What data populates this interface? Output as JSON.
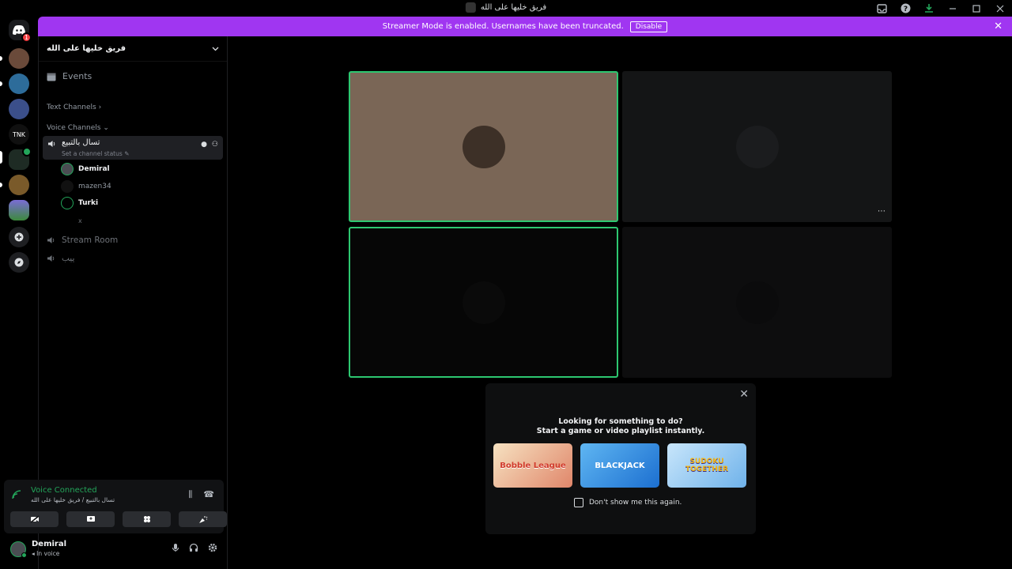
{
  "window": {
    "title": "فريق خليها على الله",
    "icons": [
      "inbox-icon",
      "help-icon",
      "download-icon",
      "minimize-icon",
      "maximize-icon",
      "close-icon"
    ]
  },
  "banner": {
    "text": "Streamer Mode is enabled. Usernames have been truncated.",
    "button": "Disable"
  },
  "rail": {
    "badge": "1",
    "servers": [
      "",
      "",
      "",
      "TNK",
      "",
      "",
      ""
    ]
  },
  "guild": {
    "name": "فريق خليها على الله"
  },
  "sidebar": {
    "events": "Events",
    "text_channels": "Text Channels",
    "voice_channels": "Voice Channels",
    "active_channel": {
      "name": "تسال بالتبيع",
      "status": "Set a channel status"
    },
    "members": [
      {
        "name": "Demiral",
        "bold": true
      },
      {
        "name": "mazen34",
        "bold": false
      },
      {
        "name": "Turki",
        "bold": true
      },
      {
        "name": "x",
        "bold": false
      }
    ],
    "channels": [
      {
        "name": "Stream Room"
      },
      {
        "name": "ييب"
      }
    ]
  },
  "voice_panel": {
    "title": "Voice Connected",
    "subtitle": "تسال بالتبيع / فريق خليها على الله"
  },
  "user": {
    "name": "Demiral",
    "state": "In voice"
  },
  "popup": {
    "line1": "Looking for something to do?",
    "line2": "Start a game or video playlist instantly.",
    "games": [
      {
        "name": "Bobble League",
        "color": "#f0d9b5"
      },
      {
        "name": "BLACKJACK",
        "color": "#1f8fe0"
      },
      {
        "name": "SUDOKU TOGETHER",
        "color": "#7ec7f2"
      }
    ],
    "dont_show": "Don't show me this again."
  },
  "colors": {
    "speaking": "#2dc770",
    "banner": "#a036f1",
    "voice_green": "#23a55a"
  }
}
